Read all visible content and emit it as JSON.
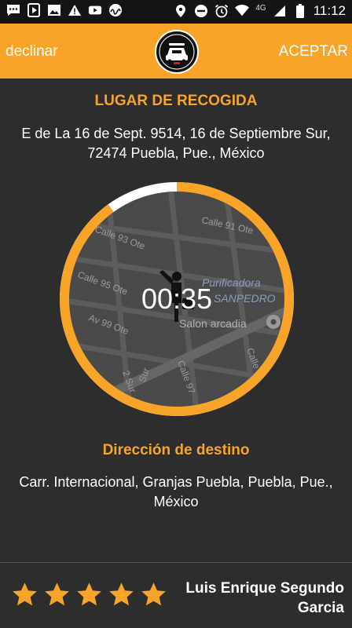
{
  "status_bar": {
    "network_label": "4G",
    "time": "11:12",
    "icons": [
      "chat-icon",
      "play-icon",
      "image-icon",
      "warning-icon",
      "youtube-icon",
      "signal-app-icon",
      "location-icon",
      "dnd-icon",
      "alarm-icon",
      "wifi-icon",
      "cell-signal-icon",
      "battery-icon"
    ]
  },
  "header": {
    "decline_label": "declinar",
    "accept_label": "ACEPTAR",
    "logo_icon": "taxi-logo-icon"
  },
  "pickup": {
    "title": "LUGAR DE RECOGIDA",
    "address": "E de La 16 de Sept. 9514, 16 de Septiembre Sur, 72474 Puebla, Pue., México"
  },
  "timer": {
    "time_left": "00:35",
    "progress": 0.9,
    "map": {
      "streets": [
        "Calle 91 Ote",
        "Calle 93 Ote",
        "Calle 95 Ote",
        "Av 99 Ote",
        "Calle 97",
        "Calle",
        "2 Sur",
        "Sur"
      ],
      "places": [
        "Purificadora",
        "SANPEDRO",
        "Salon arcadia"
      ]
    }
  },
  "destination": {
    "title": "Dirección de destino",
    "address": "Carr. Internacional, Granjas Puebla, Puebla, Pue., México"
  },
  "driver": {
    "name": "Luis Enrique Segundo Garcia",
    "rating": 5,
    "rating_max": 5
  },
  "colors": {
    "accent": "#f8a428",
    "background": "#2d2d2d",
    "status_bar": "#141414",
    "map_bg": "#4a4a4a"
  }
}
